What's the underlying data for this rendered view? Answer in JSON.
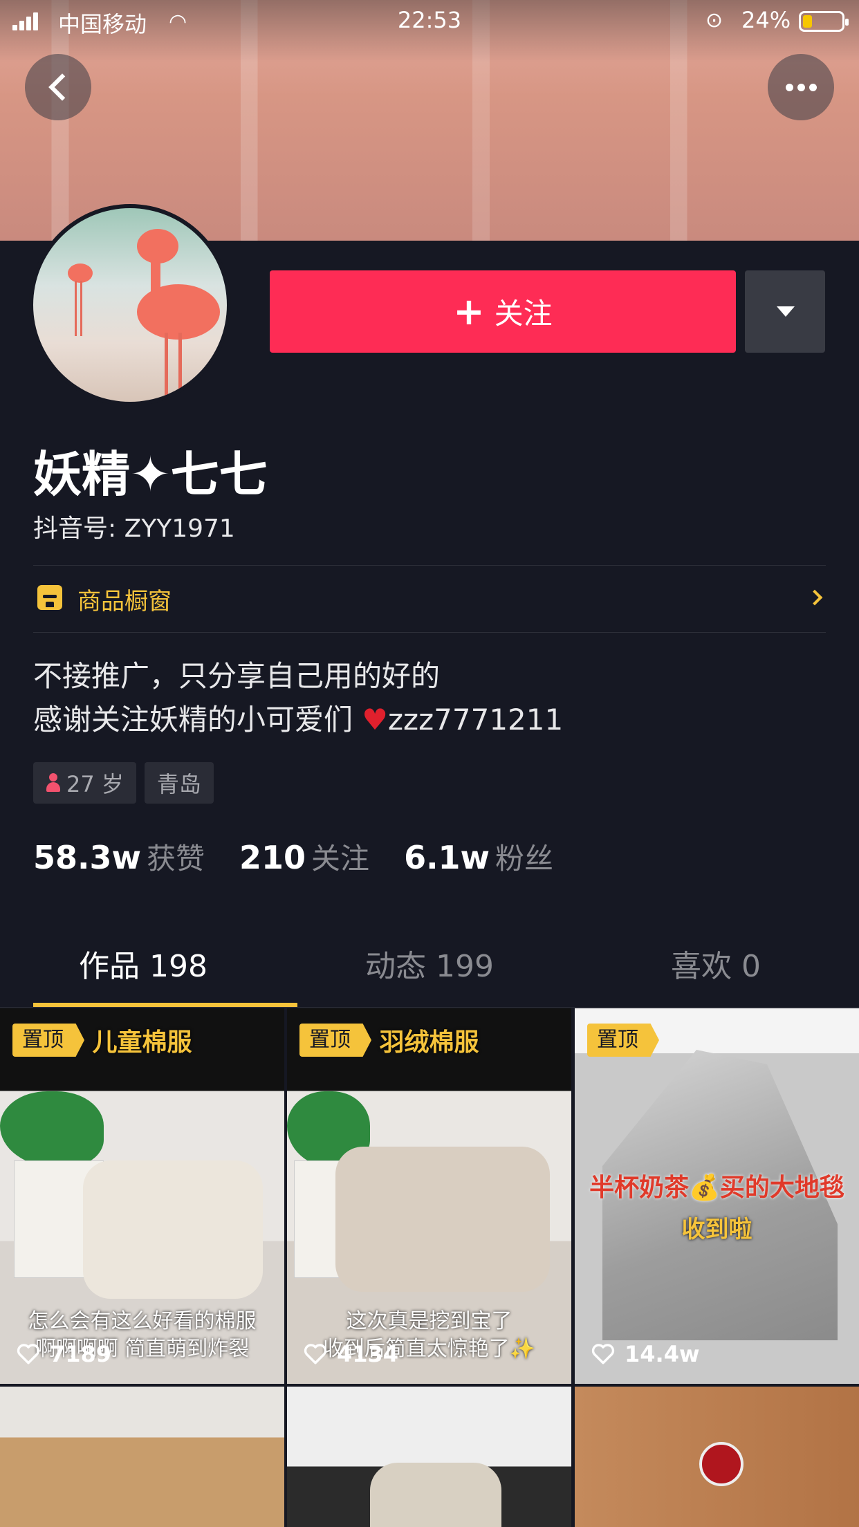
{
  "status_bar": {
    "carrier": "中国移动",
    "time": "22:53",
    "battery_pct": "24%",
    "battery_level": 0.24
  },
  "profile": {
    "follow_label": "关注",
    "name": "妖精✦七七",
    "douyin_id": "抖音号: ZYY1971",
    "shop_label": "商品橱窗",
    "bio_line1": "不接推广，只分享自己用的好的",
    "bio_line2_text": "感谢关注妖精的小可爱们 ",
    "bio_line2_heart": "♥",
    "bio_line2_suffix": "zzz7771211",
    "tags": [
      "27 岁",
      "青岛"
    ]
  },
  "stats": [
    {
      "num": "58.3w",
      "label": "获赞"
    },
    {
      "num": "210",
      "label": "关注"
    },
    {
      "num": "6.1w",
      "label": "粉丝"
    }
  ],
  "tabs": [
    {
      "label": "作品 198"
    },
    {
      "label": "动态 199"
    },
    {
      "label": "喜欢 0"
    }
  ],
  "videos": [
    {
      "pin": "置顶",
      "title": "儿童棉服",
      "caption1": "怎么会有这么好看的棉服",
      "caption2": "啊啊啊啊 简直萌到炸裂",
      "likes": "7189"
    },
    {
      "pin": "置顶",
      "title": "羽绒棉服",
      "caption1": "这次真是挖到宝了",
      "caption2": "收到后简直太惊艳了✨",
      "likes": "4134"
    },
    {
      "pin": "置顶",
      "title": "",
      "caption1": "半杯奶茶💰买的大地毯",
      "caption2": "收到啦",
      "likes": "14.4w"
    }
  ],
  "icons": {
    "back": "back-arrow-icon",
    "more": "more-icon",
    "dropdown": "caret-down-icon",
    "shop": "shop-icon",
    "heart": "heart-icon"
  },
  "colors": {
    "accent": "#fe2c55",
    "highlight": "#f5c33b",
    "background": "#161823"
  }
}
